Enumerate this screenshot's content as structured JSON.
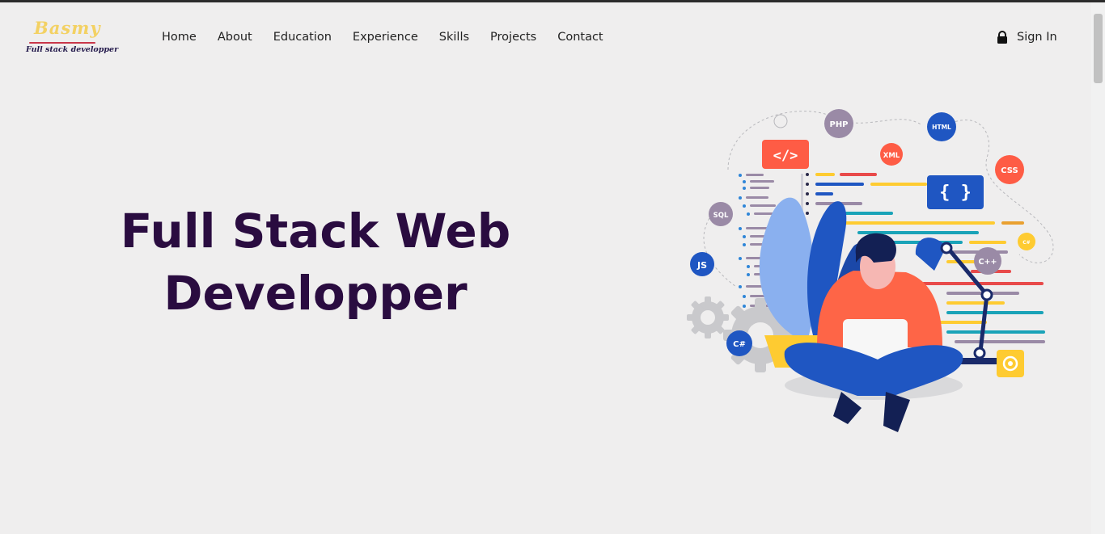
{
  "logo": {
    "name": "Basmy",
    "tagline": "Full stack developper"
  },
  "nav": [
    "Home",
    "About",
    "Education",
    "Experience",
    "Skills",
    "Projects",
    "Contact"
  ],
  "signin": {
    "icon": "lock-icon",
    "label": "Sign In"
  },
  "hero": {
    "line1": "Full Stack Web",
    "line2": "Developper"
  },
  "illustration": {
    "badges": [
      "PHP",
      "HTML",
      "XML",
      "CSS",
      "SQL",
      "JS",
      "C++",
      "C#",
      "C#"
    ],
    "code_symbol": "</>",
    "braces": "{ }"
  },
  "colors": {
    "background": "#efeeee",
    "heading": "#2a0c40",
    "accent_blue": "#1f56c2",
    "accent_red": "#fe5c45",
    "accent_yellow": "#fecb31",
    "gray_badge": "#9a8aa6"
  }
}
